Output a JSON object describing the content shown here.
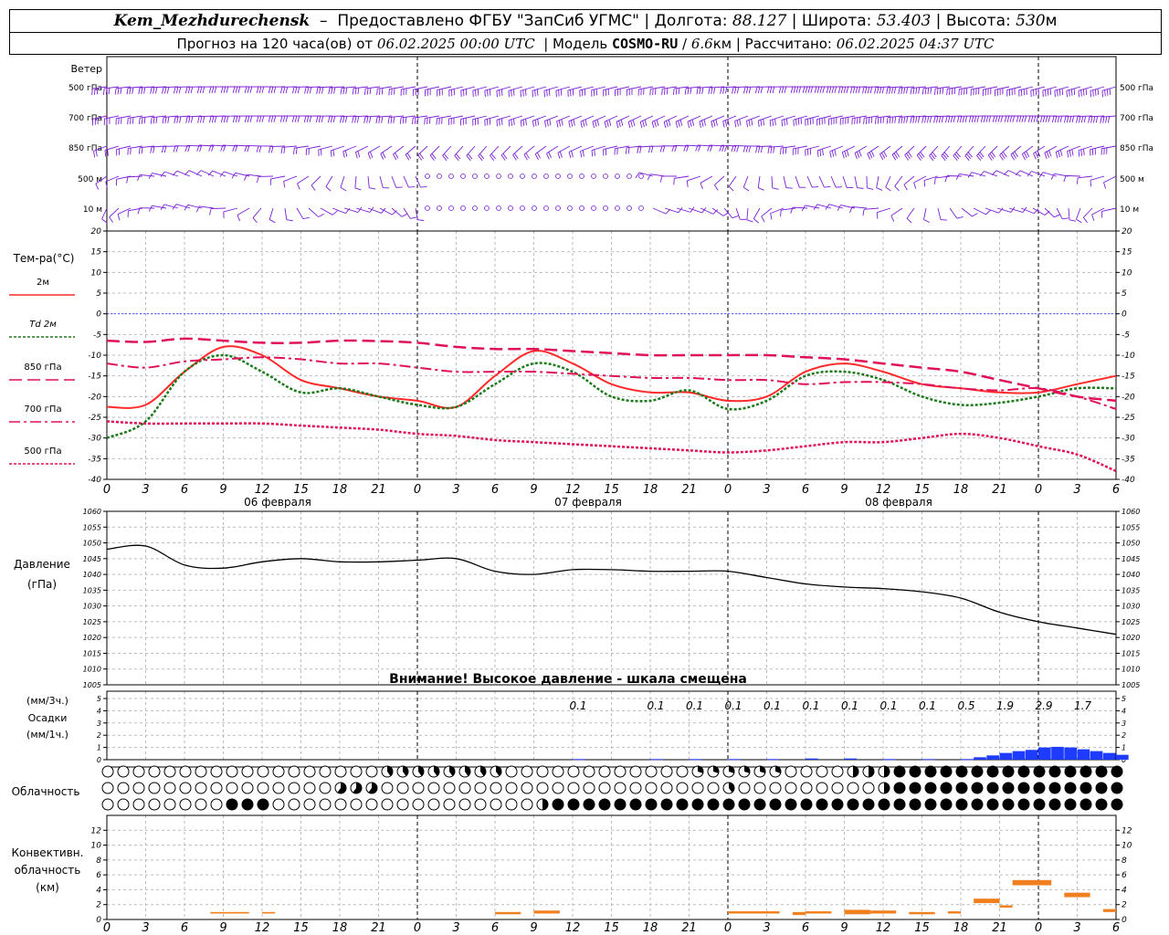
{
  "header": {
    "station": "Kem_Mezhdurechensk",
    "dash": "–",
    "provider": "Предоставлено ФГБУ \"ЗапСиб УГМС\"",
    "lon_label": "Долгота:",
    "lon": "88.127",
    "lat_label": "Широта:",
    "lat": "53.403",
    "alt_label": "Высота:",
    "alt": "530",
    "alt_unit": "м",
    "forecast_label": "Прогноз на 120 часа(ов)",
    "from_label": "от",
    "forecast_start": "06.02.2025 00:00 UTC",
    "model_label": "Модель",
    "model": "COSMO-RU",
    "resolution": "6.6",
    "resolution_unit": "км",
    "computed_label": "Рассчитано:",
    "computed": "06.02.2025 04:37 UTC"
  },
  "wind": {
    "title": "Ветер",
    "levels": [
      "500 гПа",
      "700 гПа",
      "850 гПа",
      "500 м",
      "10 м"
    ],
    "color": "#7b1fd6"
  },
  "temperature": {
    "title": "Тем-ра(°C)",
    "legend": [
      {
        "label": "2м",
        "color": "#ff2a2a",
        "style": "solid"
      },
      {
        "label": "Td 2м",
        "color": "#1a7a1a",
        "style": "dotted"
      },
      {
        "label": "850 гПа",
        "color": "#e0105a",
        "style": "longdash"
      },
      {
        "label": "700 гПа",
        "color": "#e0105a",
        "style": "dashdot"
      },
      {
        "label": "500 гПа",
        "color": "#e0105a",
        "style": "dotted"
      }
    ]
  },
  "pressure": {
    "title": "Давление",
    "unit": "(гПа)",
    "warning": "Внимание! Высокое давление - шкала смещена"
  },
  "precip": {
    "unit3": "(мм/3ч.)",
    "title": "Осадки",
    "unit1": "(мм/1ч.)",
    "color": "#1e3cff"
  },
  "cloud": {
    "title": "Облачность"
  },
  "convective": {
    "title1": "Конвективн.",
    "title2": "облачность",
    "unit": "(км)",
    "color": "#f07f1e"
  },
  "days": [
    "06 февраля",
    "07 февраля",
    "08 февраля"
  ],
  "chart_data": [
    {
      "type": "line",
      "title": "Тем-ра(°C)",
      "x_hours": [
        0,
        3,
        6,
        9,
        12,
        15,
        18,
        21,
        24,
        27,
        30,
        33,
        36,
        39,
        42,
        45,
        48,
        51,
        54,
        57,
        60,
        63,
        66,
        69,
        72,
        75,
        78,
        81,
        84,
        87,
        90,
        93,
        96,
        99,
        102
      ],
      "x_tick_labels": [
        "0",
        "3",
        "6",
        "9",
        "12",
        "15",
        "18",
        "21",
        "0",
        "3",
        "6",
        "9",
        "12",
        "15",
        "18",
        "21",
        "0",
        "3",
        "6",
        "9",
        "12",
        "15",
        "18",
        "21",
        "0",
        "3",
        "6"
      ],
      "ylim": [
        -40,
        20
      ],
      "y_ticks": [
        -40,
        -35,
        -30,
        -25,
        -20,
        -15,
        -10,
        -5,
        0,
        5,
        10,
        15,
        20
      ],
      "series": [
        {
          "name": "2м",
          "values": [
            -22.5,
            -22,
            -14,
            -8,
            -10,
            -16,
            -18,
            -20,
            -21,
            -22.5,
            -15,
            -9,
            -12,
            -17,
            -19,
            -19,
            -21,
            -20,
            -14,
            -12,
            -14,
            -17,
            -18,
            -19,
            -19,
            -17,
            -15,
            -15,
            -15,
            -15,
            -15,
            -15,
            -15,
            -15,
            -15
          ]
        },
        {
          "name": "Td 2м",
          "values": [
            -30,
            -26,
            -14,
            -10,
            -14,
            -19,
            -18,
            -20,
            -22,
            -22.5,
            -17,
            -12,
            -14,
            -20,
            -21,
            -18.5,
            -23,
            -21,
            -15,
            -14,
            -16,
            -20,
            -22,
            -21.5,
            -20,
            -18,
            -18,
            -18,
            -18,
            -18,
            -18,
            -18,
            -18,
            -18,
            -18
          ]
        },
        {
          "name": "850 гПа",
          "values": [
            -6.5,
            -6.8,
            -6,
            -6.5,
            -7,
            -7,
            -6.5,
            -6.6,
            -7,
            -8,
            -8.5,
            -8.5,
            -9,
            -9.5,
            -10,
            -10,
            -10,
            -10,
            -10.5,
            -11,
            -12,
            -13,
            -14,
            -16,
            -18,
            -20,
            -21,
            -21,
            -21,
            -21,
            -21,
            -21,
            -21,
            -21,
            -21
          ]
        },
        {
          "name": "700 гПа",
          "values": [
            -12,
            -13,
            -11.5,
            -11,
            -10.5,
            -11,
            -12,
            -12,
            -13,
            -14,
            -14,
            -14,
            -14.5,
            -15,
            -15.5,
            -15.5,
            -16,
            -16,
            -17,
            -16.5,
            -16.5,
            -17,
            -18,
            -18.5,
            -18,
            -20,
            -23,
            -23,
            -23,
            -23,
            -23,
            -23,
            -23,
            -23,
            -23
          ]
        },
        {
          "name": "500 гПа",
          "values": [
            -26,
            -26.5,
            -26.5,
            -26.5,
            -26.5,
            -27,
            -27.5,
            -28,
            -29,
            -29.5,
            -30.5,
            -31,
            -31.5,
            -32,
            -32.5,
            -33,
            -33.5,
            -33,
            -32,
            -31,
            -31,
            -30,
            -29,
            -30,
            -32,
            -34,
            -38,
            -38,
            -38,
            -38,
            -38,
            -38,
            -38,
            -38,
            -38
          ]
        }
      ],
      "grid": true
    },
    {
      "type": "line",
      "title": "Давление",
      "ylabel": "(гПа)",
      "x_hours": [
        0,
        3,
        6,
        9,
        12,
        15,
        18,
        21,
        24,
        27,
        30,
        33,
        36,
        39,
        42,
        45,
        48,
        51,
        54,
        57,
        60,
        63,
        66,
        69,
        72,
        75,
        78
      ],
      "ylim": [
        1005,
        1060
      ],
      "y_ticks": [
        1005,
        1010,
        1015,
        1020,
        1025,
        1030,
        1035,
        1040,
        1045,
        1050,
        1055,
        1060
      ],
      "series": [
        {
          "name": "Давление",
          "values": [
            1048,
            1049,
            1043,
            1042,
            1044,
            1045,
            1044,
            1044,
            1044.5,
            1045,
            1041,
            1040,
            1041.5,
            1041.5,
            1041,
            1041,
            1041,
            1039,
            1037,
            1036,
            1035.5,
            1034.5,
            1032.5,
            1028,
            1025,
            1023,
            1021
          ]
        }
      ],
      "annotation": "Внимание! Высокое давление - шкала смещена",
      "grid": true
    },
    {
      "type": "bar",
      "title": "Осадки",
      "ylabel": "(мм/3ч.) (мм/1ч.)",
      "ylim": [
        0,
        5
      ],
      "y_ticks": [
        0,
        1,
        2,
        3,
        4,
        5
      ],
      "label_hours": [
        36,
        42,
        45,
        48,
        51,
        54,
        57,
        60,
        63,
        66,
        69,
        72,
        75
      ],
      "labels_3h": [
        "0.1",
        "0.1",
        "0.1",
        "0.1",
        "0.1",
        "0.1",
        "0.1",
        "0.1",
        "0.1",
        "0.5",
        "1.9",
        "2.9",
        "1.7"
      ],
      "bar_hours": [
        36,
        42,
        45,
        48,
        51,
        54,
        57,
        60,
        63,
        66,
        67,
        68,
        69,
        70,
        71,
        72,
        73,
        74,
        75,
        76,
        77,
        78
      ],
      "hourly_values": [
        0.05,
        0.05,
        0.05,
        0.05,
        0.05,
        0.1,
        0.1,
        0.05,
        0.05,
        0.05,
        0.2,
        0.35,
        0.55,
        0.7,
        0.8,
        1.0,
        1.05,
        1.0,
        0.85,
        0.7,
        0.55,
        0.4
      ],
      "grid": true
    },
    {
      "type": "bar",
      "title": "Конвективн. облачность",
      "ylabel": "(км)",
      "ylim": [
        0,
        14
      ],
      "y_ticks": [
        0,
        2,
        4,
        6,
        8,
        10,
        12
      ],
      "segments": [
        {
          "start_hour": 8,
          "end_hour": 11,
          "base": 0.8,
          "top": 1.0
        },
        {
          "start_hour": 12,
          "end_hour": 13,
          "base": 0.8,
          "top": 1.0
        },
        {
          "start_hour": 30,
          "end_hour": 32,
          "base": 0.7,
          "top": 1.0
        },
        {
          "start_hour": 33,
          "end_hour": 35,
          "base": 0.8,
          "top": 1.2
        },
        {
          "start_hour": 48,
          "end_hour": 52,
          "base": 0.8,
          "top": 1.1
        },
        {
          "start_hour": 53,
          "end_hour": 54,
          "base": 0.6,
          "top": 1.0
        },
        {
          "start_hour": 54,
          "end_hour": 56,
          "base": 0.8,
          "top": 1.1
        },
        {
          "start_hour": 57,
          "end_hour": 59,
          "base": 0.7,
          "top": 1.3
        },
        {
          "start_hour": 59,
          "end_hour": 61,
          "base": 0.8,
          "top": 1.2
        },
        {
          "start_hour": 62,
          "end_hour": 64,
          "base": 0.7,
          "top": 1.0
        },
        {
          "start_hour": 65,
          "end_hour": 66,
          "base": 0.8,
          "top": 1.1
        },
        {
          "start_hour": 67,
          "end_hour": 69,
          "base": 2.2,
          "top": 2.8
        },
        {
          "start_hour": 69,
          "end_hour": 70,
          "base": 1.6,
          "top": 1.9
        },
        {
          "start_hour": 70,
          "end_hour": 73,
          "base": 4.6,
          "top": 5.3
        },
        {
          "start_hour": 74,
          "end_hour": 76,
          "base": 3.0,
          "top": 3.6
        },
        {
          "start_hour": 77,
          "end_hour": 78,
          "base": 1.0,
          "top": 1.4
        }
      ]
    }
  ]
}
